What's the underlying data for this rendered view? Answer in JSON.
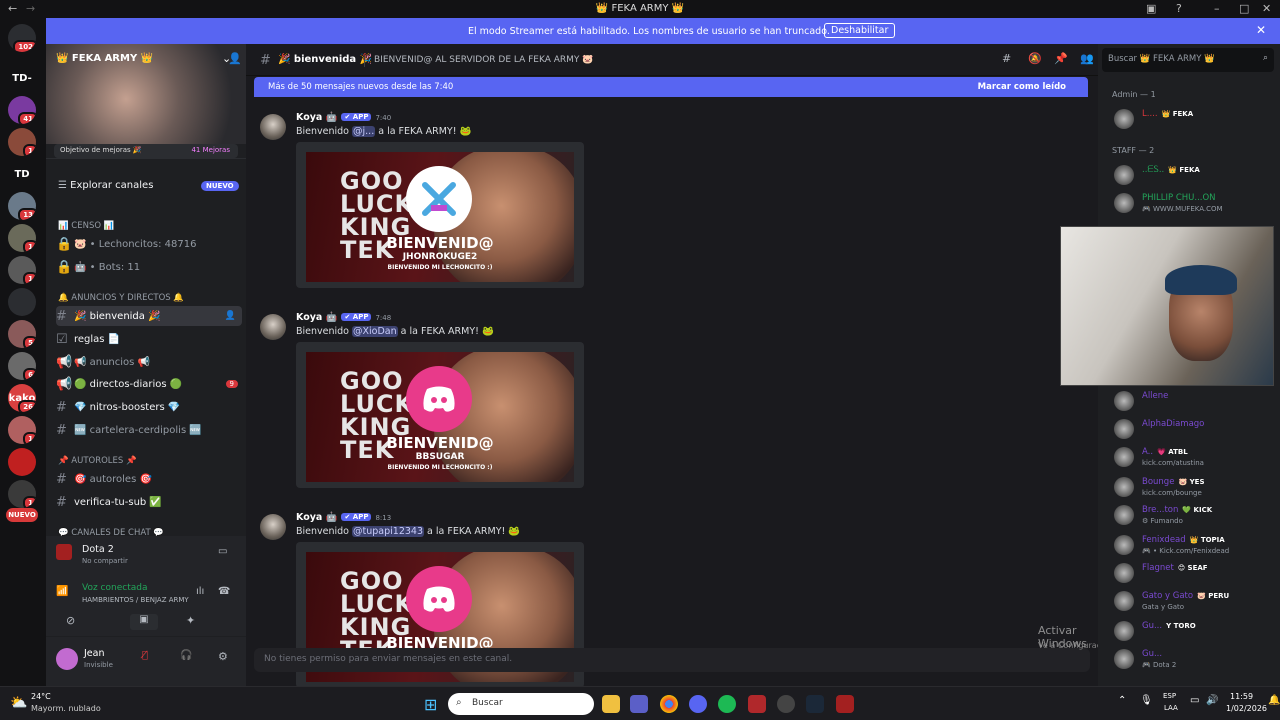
{
  "window": {
    "title": "👑 FEKA ARMY 👑"
  },
  "streamer": {
    "message": "El modo Streamer está habilitado. Los nombres de usuario se han truncado.",
    "button": "Deshabilitar"
  },
  "guilds": [
    {
      "label": "",
      "badge": "102",
      "color": "#2b2d31"
    },
    {
      "label": "TD-",
      "badge": "",
      "color": "#121214"
    },
    {
      "label": "",
      "badge": "41",
      "color": "#7a3aa0"
    },
    {
      "label": "",
      "badge": "1",
      "color": "#8a4a3a"
    },
    {
      "label": "TD",
      "badge": "",
      "color": "#121214"
    },
    {
      "label": "",
      "badge": "13",
      "color": "#6a7a8a"
    },
    {
      "label": "",
      "badge": "1",
      "color": "#6a6a5a"
    },
    {
      "label": "",
      "badge": "1",
      "color": "#5a5a5a"
    },
    {
      "label": "",
      "badge": "",
      "color": "#2b2d31"
    },
    {
      "label": "",
      "badge": "5",
      "color": "#8a5a5a"
    },
    {
      "label": "",
      "badge": "6",
      "color": "#6a6a6a"
    },
    {
      "label": "kako",
      "badge": "26",
      "color": "#d94040"
    },
    {
      "label": "",
      "badge": "1",
      "color": "#b06060"
    },
    {
      "label": "",
      "badge": "",
      "color": "#c02020"
    },
    {
      "label": "",
      "badge": "1",
      "color": "#3a3a3a"
    },
    {
      "label": "NUEVO",
      "badge": "",
      "color": "#d83a3a"
    }
  ],
  "server": {
    "name": "👑 FEKA ARMY 👑",
    "boost_goal": "Objetivo de mejoras 🎉",
    "boost_count": "41 Mejoras",
    "explore": "Explorar canales",
    "explore_badge": "NUEVO"
  },
  "categories": {
    "censo": "📊 CENSO 📊",
    "anuncios": "🔔 ANUNCIOS Y DIRECTOS 🔔",
    "autoroles": "📌 AUTOROLES 📌",
    "chat": "💬 CANALES DE CHAT 💬"
  },
  "channels": {
    "lechoncitos": "🐷 • Lechoncitos: 48716",
    "bots": "🤖 • Bots: 11",
    "bienvenida": "🎉 bienvenida 🎉",
    "reglas": "reglas 📄",
    "anuncios": "📢 anuncios 📢",
    "directos": "🟢 directos-diarios 🟢",
    "directos_badge": "9",
    "nitros": "💎 nitros-boosters 💎",
    "cartelera": "🆕 cartelera-cerdipolis 🆕",
    "autoroles": "🎯 autoroles 🎯",
    "verifica": "verifica-tu-sub ✅"
  },
  "activity": {
    "game": "Dota 2",
    "sub": "No compartir"
  },
  "voice": {
    "status": "Voz conectada",
    "channel": "HAMBRIENTOS / BENJAZ ARMY"
  },
  "user": {
    "name": "Jean",
    "status": "Invisible"
  },
  "header": {
    "channel": "🎉 bienvenida 🎉",
    "topic": "BIENVENID@ AL SERVIDOR DE LA FEKA ARMY 🐷",
    "search_placeholder": "Buscar 👑 FEKA ARMY 👑"
  },
  "newbar": {
    "text": "Más de 50 mensajes nuevos desde las 7:40",
    "mark": "Marcar como leído"
  },
  "messages": [
    {
      "author": "Koya 🤖",
      "tag": "✔ APP",
      "time": "7:40",
      "pre": "Bienvenido ",
      "mention": "@j...",
      "post": " a la FEKA ARMY! 🐸",
      "banner_name": "JHONROKUGE2",
      "banner_title": "BIENVENID@",
      "banner_sub": "BIENVENIDO MI LECHONCITO :)",
      "icon": "swords",
      "bigtext": [
        "GOO",
        "LUCK",
        "KING",
        "TEK"
      ]
    },
    {
      "author": "Koya 🤖",
      "tag": "✔ APP",
      "time": "7:48",
      "pre": "Bienvenido ",
      "mention": "@XioDan",
      "post": " a la FEKA ARMY! 🐸",
      "banner_name": "BBSUGAR",
      "banner_title": "BIENVENID@",
      "banner_sub": "BIENVENIDO MI LECHONCITO :)",
      "icon": "discord",
      "bigtext": [
        "GOO",
        "LUCK",
        "KING",
        "TEK"
      ]
    },
    {
      "author": "Koya 🤖",
      "tag": "✔ APP",
      "time": "8:13",
      "pre": "Bienvenido ",
      "mention": "@tupapi12343",
      "post": " a la FEKA ARMY! 🐸",
      "banner_name": "",
      "banner_title": "BIENVENID@",
      "banner_sub": "",
      "icon": "discord",
      "bigtext": [
        "GOO",
        "LUCK",
        "KING",
        "TEK"
      ]
    }
  ],
  "composer": {
    "placeholder": "No tienes permiso para enviar mensajes en este canal."
  },
  "members": {
    "admin_header": "Admin — 1",
    "staff_header": "STAFF — 2",
    "list": [
      {
        "name": "L....",
        "tag": "👑 FEKA",
        "sub": "",
        "color": "#da373c"
      },
      {
        "name": "..ᗴᏚ..",
        "tag": "👑 FEKA",
        "sub": "",
        "color": "#23a55a"
      },
      {
        "name": "PHILLIP CHU...ON",
        "tag": "",
        "sub": "🎮 WWW.MUFEKA.COM",
        "color": "#23a55a"
      },
      {
        "name": "Allene",
        "tag": "",
        "sub": "",
        "color": "#7a4ad0"
      },
      {
        "name": "AlphaDiamago",
        "tag": "",
        "sub": "",
        "color": "#7a4ad0"
      },
      {
        "name": "A..",
        "tag": "💗 ATBL",
        "sub": "kick.com/atustina",
        "color": "#7a4ad0"
      },
      {
        "name": "Bounge",
        "tag": "🐷 YES",
        "sub": "kick.com/bounge",
        "color": "#7a4ad0"
      },
      {
        "name": "Bre...ton",
        "tag": "💚 KICK",
        "sub": "⚙ Fumando",
        "color": "#7a4ad0"
      },
      {
        "name": "Fenixdead",
        "tag": "👑 TOPIA",
        "sub": "🎮 • Kick.com/Fenixdead",
        "color": "#7a4ad0"
      },
      {
        "name": "Flagnet",
        "tag": "😊 SEAF",
        "sub": "",
        "color": "#7a4ad0"
      },
      {
        "name": "Gato y Gato",
        "tag": "🐷 PERU",
        "sub": "Gata y Gato",
        "color": "#7a4ad0"
      },
      {
        "name": "Gu...",
        "tag": "Y TORO",
        "sub": "",
        "color": "#7a4ad0"
      },
      {
        "name": "Gu...",
        "tag": "",
        "sub": "🎮 Dota 2",
        "color": "#7a4ad0"
      }
    ]
  },
  "watermark": {
    "line1": "Activar Windows",
    "line2": "Ve a Configuración para activar Windows."
  },
  "taskbar": {
    "weather_temp": "24°C",
    "weather_desc": "Mayorm. nublado",
    "search": "Buscar",
    "lang1": "ESP",
    "lang2": "LAA",
    "time": "11:59",
    "date": "1/02/2026"
  }
}
